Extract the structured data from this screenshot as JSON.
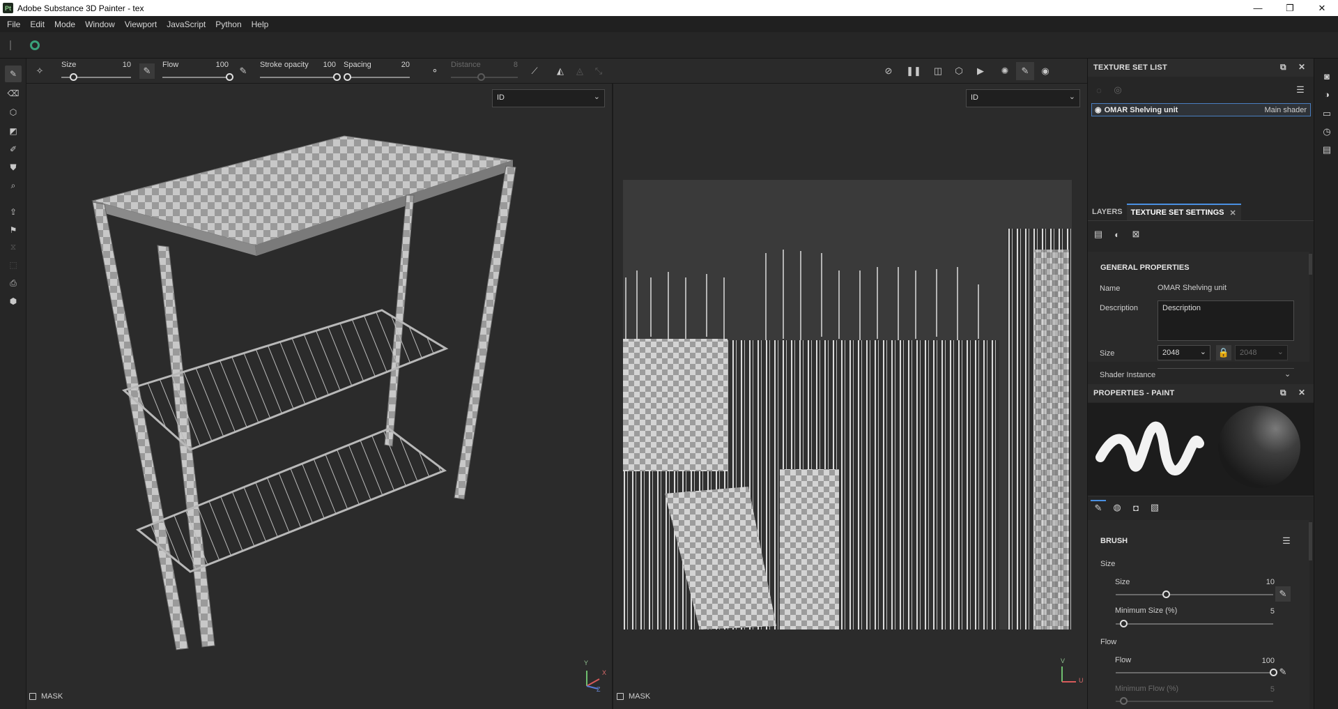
{
  "app": {
    "title": "Adobe Substance 3D Painter - tex",
    "logo_text": "Pt",
    "minimize": "—",
    "restore": "❐",
    "close": "✕"
  },
  "menu": [
    "File",
    "Edit",
    "Mode",
    "Window",
    "Viewport",
    "JavaScript",
    "Python",
    "Help"
  ],
  "toolbar": {
    "size": {
      "label": "Size",
      "value": "10",
      "level": 0.17
    },
    "flow": {
      "label": "Flow",
      "value": "100",
      "level": 1.0
    },
    "stroke_opacity": {
      "label": "Stroke opacity",
      "value": "100",
      "level": 1.0
    },
    "spacing": {
      "label": "Spacing",
      "value": "20",
      "level": 0.05
    },
    "distance": {
      "label": "Distance",
      "value": "8",
      "level": 0.45
    }
  },
  "viewport3d": {
    "display_select": "ID",
    "mask_label": "MASK",
    "axis": {
      "y": "Y",
      "x": "X",
      "z": "Z"
    }
  },
  "viewport2d": {
    "display_select": "ID",
    "mask_label": "MASK",
    "axis": {
      "v": "V",
      "u": "U"
    }
  },
  "texture_set_list": {
    "title": "TEXTURE SET LIST",
    "item_name": "OMAR Shelving unit",
    "item_shader": "Main shader"
  },
  "tabs": {
    "layers": "LAYERS",
    "texture_set_settings": "TEXTURE SET SETTINGS"
  },
  "general_properties": {
    "title": "GENERAL PROPERTIES",
    "name_label": "Name",
    "name_value": "OMAR Shelving unit",
    "description_label": "Description",
    "description_value": "Description",
    "size_label": "Size",
    "size_value": "2048",
    "size_value_locked": "2048",
    "shader_instance_label": "Shader Instance"
  },
  "properties_paint": {
    "title": "PROPERTIES - PAINT",
    "brush_title": "BRUSH",
    "size_group": "Size",
    "size_label": "Size",
    "size_value": "10",
    "size_level": 0.32,
    "min_size_label": "Minimum Size (%)",
    "min_size_value": "5",
    "min_size_level": 0.05,
    "flow_group": "Flow",
    "flow_label": "Flow",
    "flow_value": "100",
    "flow_level": 1.0,
    "min_flow_label": "Minimum Flow (%)",
    "min_flow_value": "5",
    "min_flow_level": 0.05
  },
  "colors": {
    "accent": "#4a90e2",
    "panel": "#262626",
    "viewport": "#2b2b2b"
  }
}
